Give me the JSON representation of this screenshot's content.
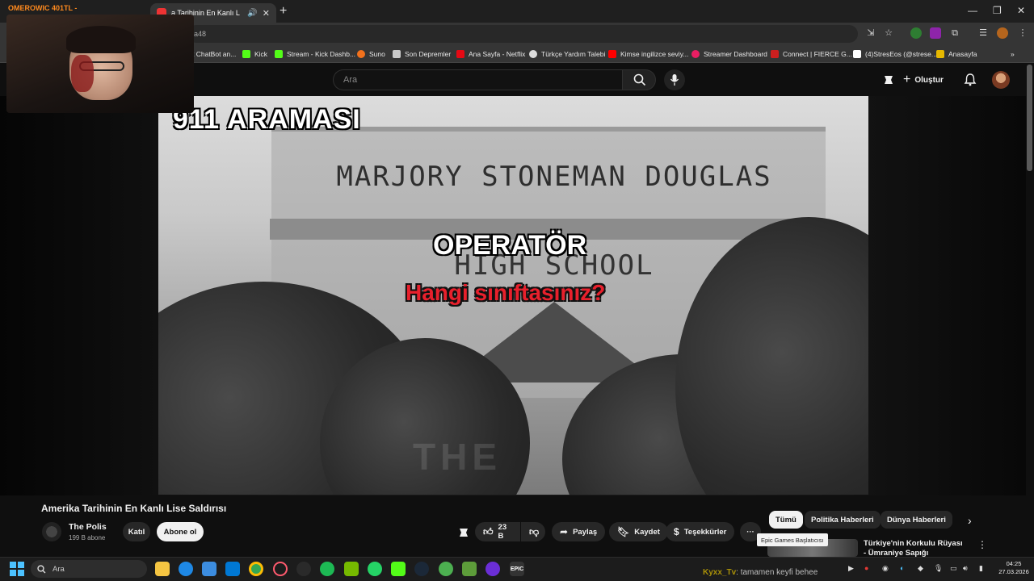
{
  "browser": {
    "tabs": [
      {
        "label": "OMEROWIC 401TL -",
        "active": false
      },
      {
        "label": "a Tarihinin En Kanlı L",
        "active": true
      }
    ],
    "url_fragment": "a48",
    "bookmarks": [
      {
        "label": "t ChatBot an...",
        "icon_color": "#7a7a7a"
      },
      {
        "label": "Kick",
        "icon_color": "#53fc18"
      },
      {
        "label": "Stream - Kick Dashb...",
        "icon_color": "#53fc18"
      },
      {
        "label": "Suno",
        "icon_color": "#f2711c"
      },
      {
        "label": "Son Depremler",
        "icon_color": "#c9c9c9"
      },
      {
        "label": "Ana Sayfa - Netflix",
        "icon_color": "#e50914"
      },
      {
        "label": "Türkçe Yardım Talebi",
        "icon_color": "#dddddd"
      },
      {
        "label": "Kimse ingilizce seviy...",
        "icon_color": "#ff0000"
      },
      {
        "label": "Streamer Dashboard",
        "icon_color": "#e91e63"
      },
      {
        "label": "Connect | FIERCE G...",
        "icon_color": "#cc1f1f"
      },
      {
        "label": "(4)StresEos (@strese...",
        "icon_color": "#ffffff"
      },
      {
        "label": "Anasayfa",
        "icon_color": "#e6b800"
      }
    ]
  },
  "youtube": {
    "search_placeholder": "Ara",
    "create_label": "Oluştur",
    "video": {
      "caption_top": "911 ARAMASI",
      "sign_line1": "MARJORY STONEMAN DOUGLAS",
      "sign_line2": "HIGH SCHOOL",
      "caption_speaker": "OPERATÖR",
      "caption_question": "Hangi sınıftasınız?",
      "watermark": "THE"
    },
    "title": "Amerika Tarihinin En Kanlı Lise Saldırısı",
    "channel": {
      "name": "The Polis",
      "subscribers": "199 B abone",
      "join_label": "Katıl",
      "subscribe_label": "Abone ol"
    },
    "actions": {
      "likes": "23 B",
      "share": "Paylaş",
      "save": "Kaydet",
      "thanks": "Teşekkürler",
      "more": "···"
    },
    "chips": [
      "Tümü",
      "Politika Haberleri",
      "Dünya Haberleri"
    ],
    "tooltip": "Epic Games Başlatıcısı",
    "recommended_title": "Türkiye'nin Korkulu Rüyası - Ümraniye Sapığı"
  },
  "webcam": {
    "label": "OMEROWIC 401TL -"
  },
  "taskbar": {
    "search_placeholder": "Ara",
    "chat_user": "Kyxx_Tv",
    "chat_message": ": tamamen keyfi behee",
    "time": "04:25",
    "date": "27.03.2026"
  }
}
